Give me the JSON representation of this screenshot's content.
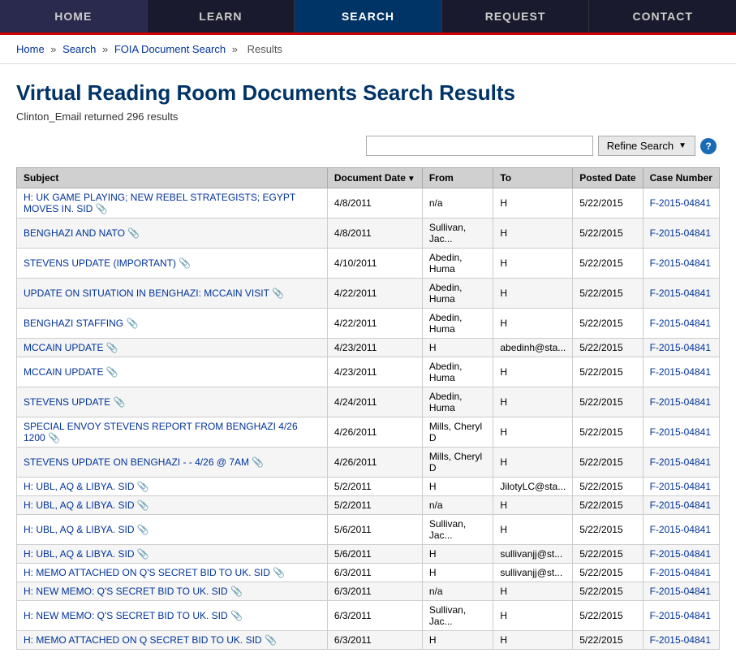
{
  "nav": {
    "items": [
      {
        "label": "HOME",
        "active": false
      },
      {
        "label": "LEARN",
        "active": false
      },
      {
        "label": "SEARCH",
        "active": true
      },
      {
        "label": "REQUEST",
        "active": false
      },
      {
        "label": "CONTACT",
        "active": false
      }
    ]
  },
  "breadcrumb": {
    "links": [
      {
        "label": "Home",
        "href": "#"
      },
      {
        "label": "Search",
        "href": "#"
      },
      {
        "label": "FOIA Document Search",
        "href": "#"
      },
      {
        "label": "Results",
        "href": null
      }
    ]
  },
  "page": {
    "title": "Virtual Reading Room Documents Search Results",
    "subtitle": "Clinton_Email returned 296 results"
  },
  "search": {
    "placeholder": "",
    "refine_label": "Refine Search",
    "info_label": "?"
  },
  "table": {
    "columns": [
      "Subject",
      "Document Date",
      "From",
      "To",
      "Posted Date",
      "Case Number"
    ],
    "rows": [
      {
        "subject": "H: UK GAME PLAYING; NEW REBEL STRATEGISTS; EGYPT MOVES IN. SID",
        "attach": true,
        "doc_date": "4/8/2011",
        "from": "n/a",
        "to": "H",
        "posted": "5/22/2015",
        "case": "F-2015-04841"
      },
      {
        "subject": "BENGHAZI AND NATO",
        "attach": true,
        "doc_date": "4/8/2011",
        "from": "Sullivan, Jac...",
        "to": "H",
        "posted": "5/22/2015",
        "case": "F-2015-04841"
      },
      {
        "subject": "STEVENS UPDATE (IMPORTANT)",
        "attach": true,
        "doc_date": "4/10/2011",
        "from": "Abedin, Huma",
        "to": "H",
        "posted": "5/22/2015",
        "case": "F-2015-04841"
      },
      {
        "subject": "UPDATE ON SITUATION IN BENGHAZI: MCCAIN VISIT",
        "attach": true,
        "doc_date": "4/22/2011",
        "from": "Abedin, Huma",
        "to": "H",
        "posted": "5/22/2015",
        "case": "F-2015-04841"
      },
      {
        "subject": "BENGHAZI STAFFING",
        "attach": true,
        "doc_date": "4/22/2011",
        "from": "Abedin, Huma",
        "to": "H",
        "posted": "5/22/2015",
        "case": "F-2015-04841"
      },
      {
        "subject": "MCCAIN UPDATE",
        "attach": true,
        "doc_date": "4/23/2011",
        "from": "H",
        "to": "abedinh@sta...",
        "posted": "5/22/2015",
        "case": "F-2015-04841"
      },
      {
        "subject": "MCCAIN UPDATE",
        "attach": true,
        "doc_date": "4/23/2011",
        "from": "Abedin, Huma",
        "to": "H",
        "posted": "5/22/2015",
        "case": "F-2015-04841"
      },
      {
        "subject": "STEVENS UPDATE",
        "attach": true,
        "doc_date": "4/24/2011",
        "from": "Abedin, Huma",
        "to": "H",
        "posted": "5/22/2015",
        "case": "F-2015-04841"
      },
      {
        "subject": "SPECIAL ENVOY STEVENS REPORT FROM BENGHAZI 4/26 1200",
        "attach": true,
        "doc_date": "4/26/2011",
        "from": "Mills, Cheryl D",
        "to": "H",
        "posted": "5/22/2015",
        "case": "F-2015-04841"
      },
      {
        "subject": "STEVENS UPDATE ON BENGHAZI - - 4/26 @ 7AM",
        "attach": true,
        "doc_date": "4/26/2011",
        "from": "Mills, Cheryl D",
        "to": "H",
        "posted": "5/22/2015",
        "case": "F-2015-04841"
      },
      {
        "subject": "H: UBL, AQ & LIBYA. SID",
        "attach": true,
        "doc_date": "5/2/2011",
        "from": "H",
        "to": "JilotyLC@sta...",
        "posted": "5/22/2015",
        "case": "F-2015-04841"
      },
      {
        "subject": "H: UBL, AQ & LIBYA. SID",
        "attach": true,
        "doc_date": "5/2/2011",
        "from": "n/a",
        "to": "H",
        "posted": "5/22/2015",
        "case": "F-2015-04841"
      },
      {
        "subject": "H: UBL, AQ & LIBYA. SID",
        "attach": true,
        "doc_date": "5/6/2011",
        "from": "Sullivan, Jac...",
        "to": "H",
        "posted": "5/22/2015",
        "case": "F-2015-04841"
      },
      {
        "subject": "H: UBL, AQ & LIBYA. SID",
        "attach": true,
        "doc_date": "5/6/2011",
        "from": "H",
        "to": "sullivanjj@st...",
        "posted": "5/22/2015",
        "case": "F-2015-04841"
      },
      {
        "subject": "H: MEMO ATTACHED ON Q'S SECRET BID TO UK. SID",
        "attach": true,
        "doc_date": "6/3/2011",
        "from": "H",
        "to": "sullivanjj@st...",
        "posted": "5/22/2015",
        "case": "F-2015-04841"
      },
      {
        "subject": "H: NEW MEMO: Q'S SECRET BID TO UK. SID",
        "attach": true,
        "doc_date": "6/3/2011",
        "from": "n/a",
        "to": "H",
        "posted": "5/22/2015",
        "case": "F-2015-04841"
      },
      {
        "subject": "H: NEW MEMO: Q'S SECRET BID TO UK. SID",
        "attach": true,
        "doc_date": "6/3/2011",
        "from": "Sullivan, Jac...",
        "to": "H",
        "posted": "5/22/2015",
        "case": "F-2015-04841"
      },
      {
        "subject": "H: MEMO ATTACHED ON Q SECRET BID TO UK. SID",
        "attach": true,
        "doc_date": "6/3/2011",
        "from": "H",
        "to": "H",
        "posted": "5/22/2015",
        "case": "F-2015-04841"
      }
    ]
  }
}
